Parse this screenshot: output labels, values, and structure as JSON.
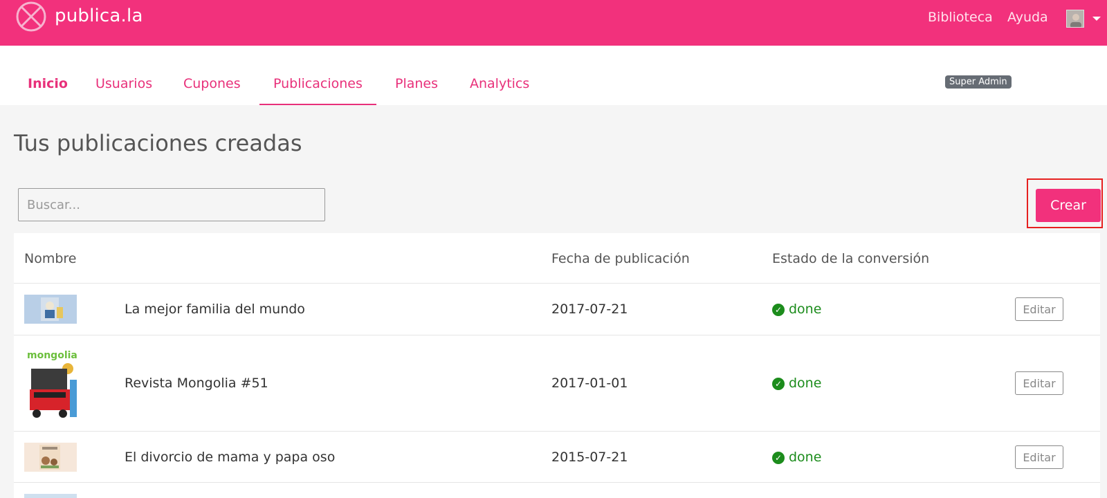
{
  "header": {
    "brand": "publica.la",
    "links": [
      "Biblioteca",
      "Ayuda"
    ],
    "brand_color": "#f2317c"
  },
  "nav": {
    "tabs": [
      "Inicio",
      "Usuarios",
      "Cupones",
      "Publicaciones",
      "Planes",
      "Analytics"
    ],
    "active_tab": "Publicaciones",
    "badge": "Super Admin"
  },
  "page": {
    "title": "Tus publicaciones creadas",
    "search_placeholder": "Buscar...",
    "create_label": "Crear"
  },
  "table": {
    "columns": [
      "Nombre",
      "Fecha de publicación",
      "Estado de la conversión"
    ],
    "rows": [
      {
        "name": "La mejor familia del mundo",
        "date": "2017-07-21",
        "status": "done",
        "action": "Editar"
      },
      {
        "name": "Revista Mongolia #51",
        "date": "2017-01-01",
        "status": "done",
        "action": "Editar"
      },
      {
        "name": "El divorcio de mama y papa oso",
        "date": "2015-07-21",
        "status": "done",
        "action": "Editar"
      }
    ],
    "status_color": "#1c8c1c"
  },
  "thumbnails": {
    "row2_logo_text": "mongolia"
  }
}
